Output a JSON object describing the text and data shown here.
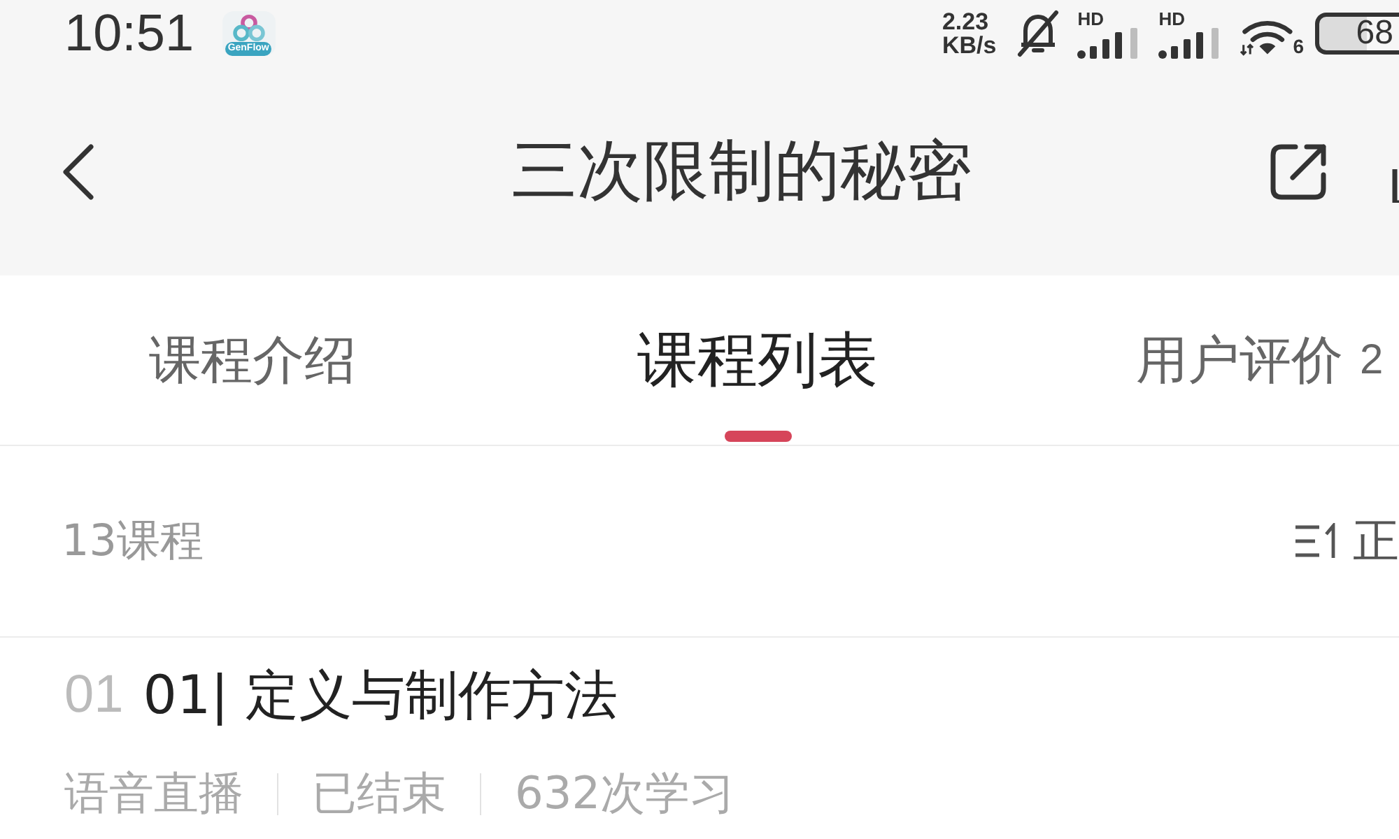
{
  "status_bar": {
    "time": "10:51",
    "app_label": "GenFlow",
    "net_speed": {
      "value": "2.23",
      "unit": "KB/s"
    },
    "signals": [
      {
        "label": "HD"
      },
      {
        "label": "HD"
      }
    ],
    "wifi_label": "6",
    "battery": "68"
  },
  "nav": {
    "title": "三次限制的秘密"
  },
  "tabs": [
    {
      "label": "课程介绍",
      "selected": false
    },
    {
      "label": "课程列表",
      "selected": true
    },
    {
      "label": "用户评价",
      "count": "2",
      "selected": false
    }
  ],
  "list_header": {
    "count": "13课程",
    "sort_label": "正"
  },
  "lessons": [
    {
      "number": "01",
      "title": "01| 定义与制作方法",
      "meta": [
        "语音直播",
        "已结束",
        "632次学习"
      ]
    }
  ]
}
